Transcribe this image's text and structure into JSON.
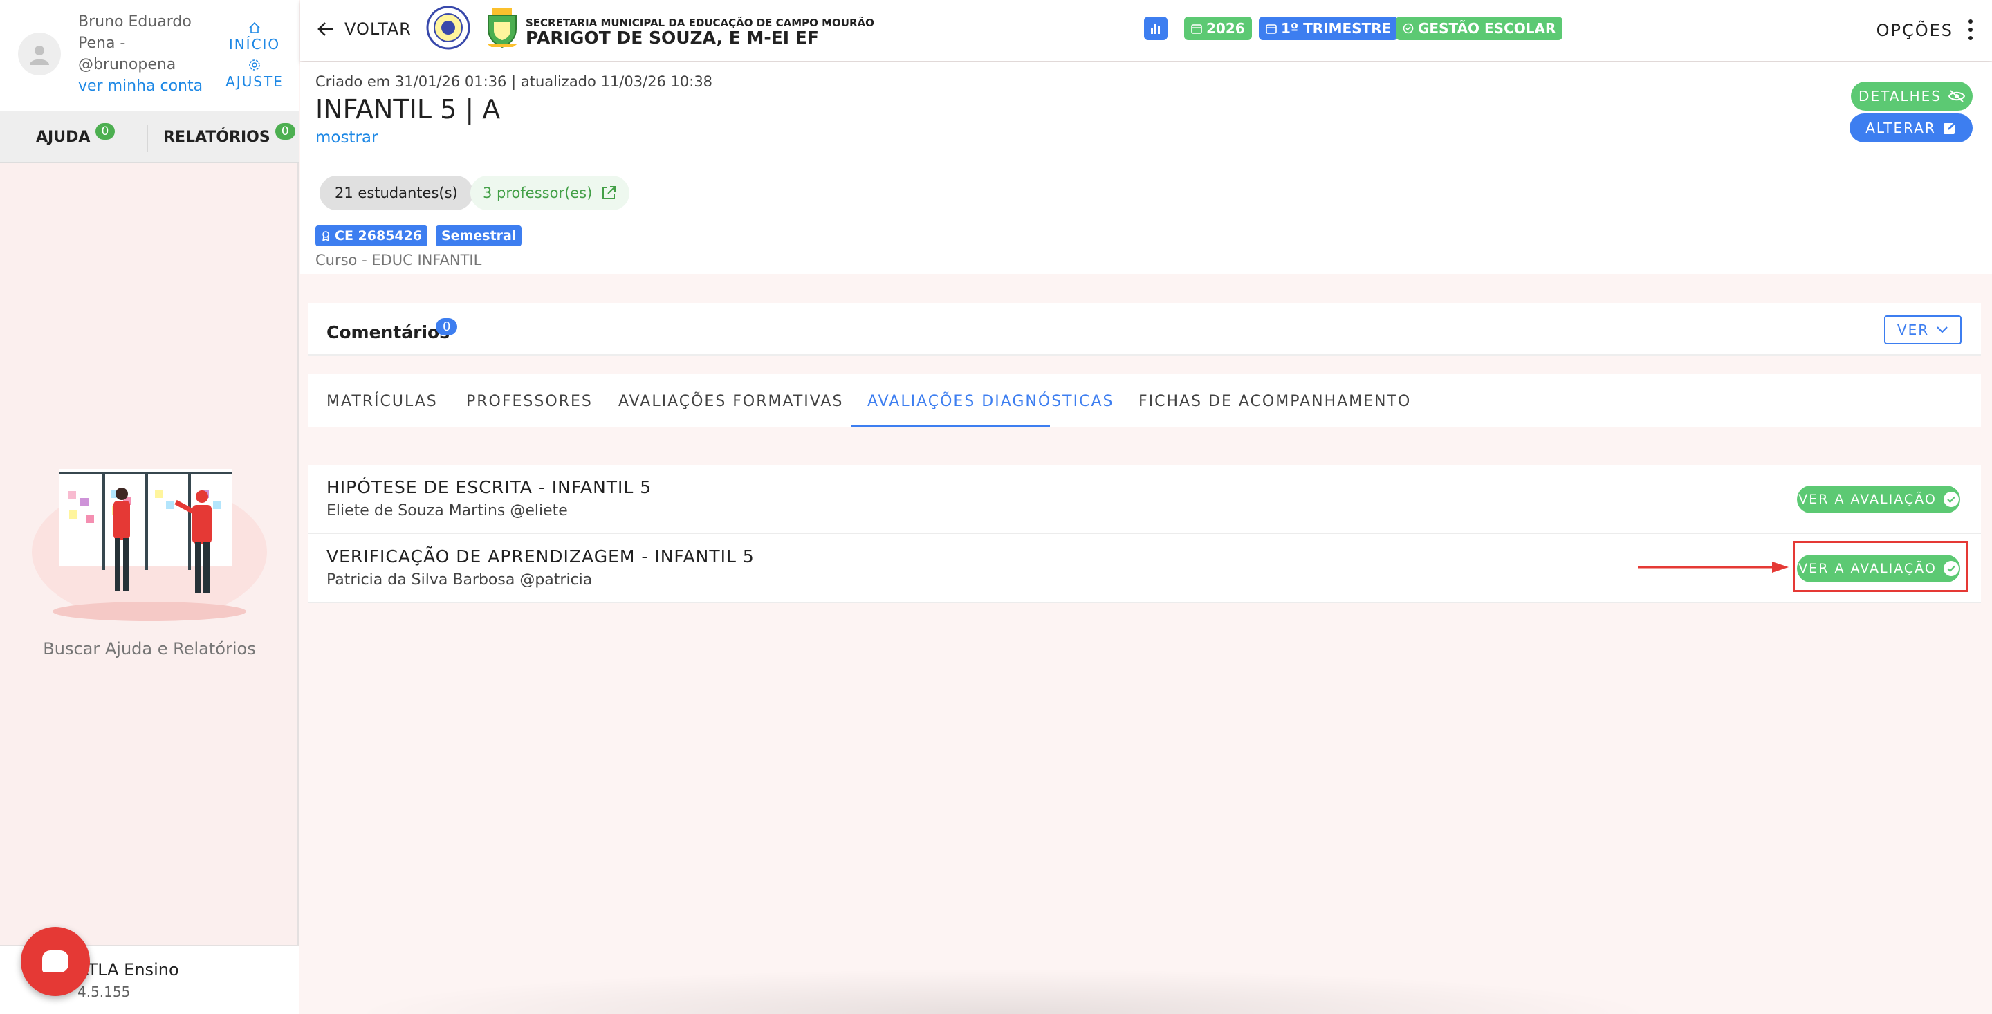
{
  "sidebar": {
    "user_name": "Bruno Eduardo Pena - @brunopena",
    "account_link": "ver minha conta",
    "nav_home": "INÍCIO",
    "nav_settings": "AJUSTE",
    "tabs": [
      {
        "label": "AJUDA",
        "count": "0"
      },
      {
        "label": "RELATÓRIOS",
        "count": "0"
      }
    ],
    "help_text": "Buscar Ajuda e Relatórios",
    "app_name": "ATLA Ensino",
    "app_version": "4.5.155"
  },
  "topbar": {
    "back_label": "VOLTAR",
    "school_subtitle": "SECRETARIA MUNICIPAL DA EDUCAÇÃO DE CAMPO MOURÃO",
    "school_name": "PARIGOT DE SOUZA, E M-EI EF",
    "year_chip": "2026",
    "term_chip": "1º TRIMESTRE",
    "mgmt_chip": "GESTÃO ESCOLAR",
    "options_label": "OPÇÕES"
  },
  "header": {
    "meta": "Criado em 31/01/26 01:36 | atualizado 11/03/26 10:38",
    "title": "INFANTIL 5 | A",
    "show_link": "mostrar",
    "students_pill": "21 estudantes(s)",
    "teachers_pill": "3 professor(es)",
    "code_tag": "CE 2685426",
    "period_tag": "Semestral",
    "course": "Curso - EDUC INFANTIL",
    "details_button": "DETALHES",
    "edit_button": "ALTERAR"
  },
  "comments": {
    "title": "Comentários",
    "count": "0",
    "ver_button": "VER"
  },
  "tabs": [
    {
      "label": "MATRÍCULAS"
    },
    {
      "label": "PROFESSORES"
    },
    {
      "label": "AVALIAÇÕES FORMATIVAS"
    },
    {
      "label": "AVALIAÇÕES DIAGNÓSTICAS",
      "active": true
    },
    {
      "label": "FICHAS DE ACOMPANHAMENTO"
    }
  ],
  "assessments": [
    {
      "title": "HIPÓTESE DE ESCRITA - INFANTIL 5",
      "author": "Eliete de Souza Martins @eliete",
      "button": "VER A AVALIAÇÃO"
    },
    {
      "title": "VERIFICAÇÃO DE APRENDIZAGEM - INFANTIL 5",
      "author": "Patricia da Silva Barbosa @patricia",
      "button": "VER A AVALIAÇÃO"
    }
  ],
  "colors": {
    "primary_blue": "#3d7ef0",
    "success_green": "#5cc973",
    "annotation_red": "#e53935"
  }
}
